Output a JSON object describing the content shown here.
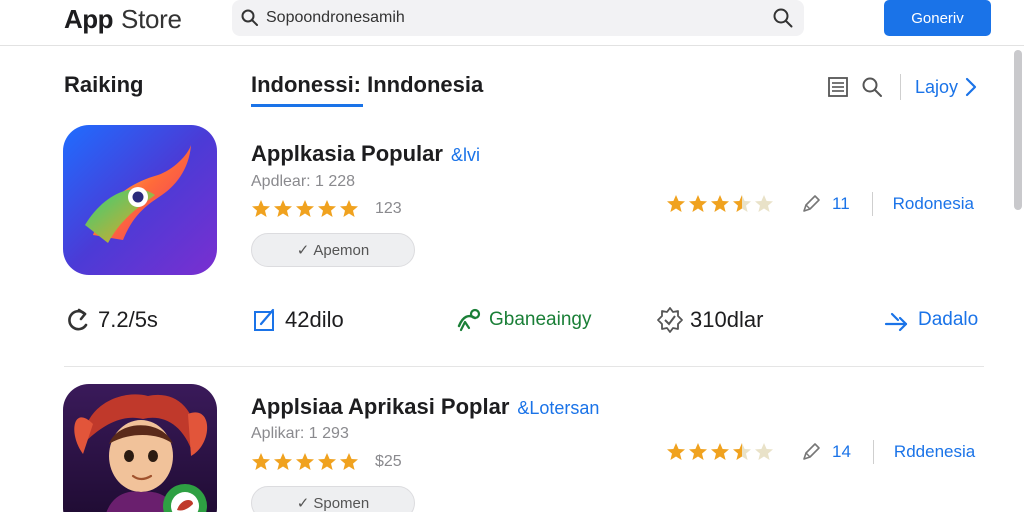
{
  "header": {
    "logo_app": "App",
    "logo_store": "Store",
    "search_value": "Sopoondronesamih",
    "primary_button": "Goneriv"
  },
  "section": {
    "title": "Raiking",
    "active_tab": "Indonessi: Inndonesia",
    "tools_link": "Lajoy"
  },
  "apps": [
    {
      "name": "Applkasia Popular",
      "tag": "&lvi",
      "subtitle": "Apdlear: 1 228",
      "stars": 5,
      "review_count": "123",
      "action": "Apemon",
      "right_stars": 3.5,
      "right_number": "11",
      "region": "Rodonesia"
    },
    {
      "name": "Applsiaa Aprikasi Poplar",
      "tag": "&Lotersan",
      "subtitle": "Aplikar: 1 293",
      "stars": 5,
      "review_count": "$25",
      "action": "Spomen",
      "right_stars": 3.5,
      "right_number": "14",
      "region": "Rddenesia"
    }
  ],
  "stats": {
    "size": "7.2/5s",
    "downloads": "42dilo",
    "category": "Gbaneaingy",
    "rank": "310dlar",
    "share": "Dadalo"
  },
  "colors": {
    "accent": "#1a73e8",
    "star": "#f0a21f",
    "star_empty": "#e9e2c8",
    "green": "#1a7f37"
  }
}
